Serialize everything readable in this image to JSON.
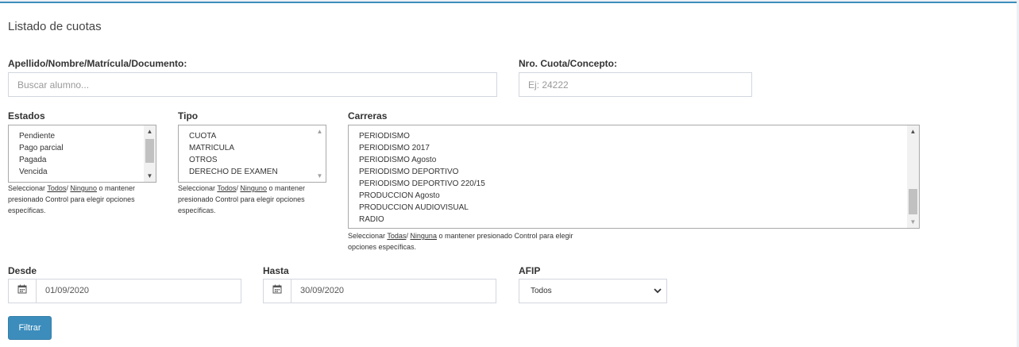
{
  "page": {
    "title": "Listado de cuotas"
  },
  "search": {
    "label": "Apellido/Nombre/Matrícula/Documento:",
    "placeholder": "Buscar alumno..."
  },
  "concepto": {
    "label": "Nro. Cuota/Concepto:",
    "placeholder": "Ej: 24222"
  },
  "estados": {
    "label": "Estados",
    "options": [
      "Pendiente",
      "Pago parcial",
      "Pagada",
      "Vencida"
    ],
    "help": {
      "pre": "Seleccionar ",
      "all": "Todos",
      "sep": "/ ",
      "none": "Ninguno",
      "post1": " o mantener",
      "post2": "presionado Control para elegir opciones",
      "post3": "específicas."
    }
  },
  "tipo": {
    "label": "Tipo",
    "options": [
      "CUOTA",
      "MATRICULA",
      "OTROS",
      "DERECHO DE EXAMEN"
    ],
    "help": {
      "pre": "Seleccionar ",
      "all": "Todos",
      "sep": "/ ",
      "none": "Ninguno",
      "post1": " o mantener",
      "post2": "presionado Control para elegir opciones",
      "post3": "específicas."
    }
  },
  "carreras": {
    "label": "Carreras",
    "options": [
      "PERIODISMO",
      "PERIODISMO 2017",
      "PERIODISMO Agosto",
      "PERIODISMO DEPORTIVO",
      "PERIODISMO DEPORTIVO 220/15",
      "PRODUCCION Agosto",
      "PRODUCCION AUDIOVISUAL",
      "RADIO"
    ],
    "help": {
      "pre": "Seleccionar ",
      "all": "Todas",
      "sep": "/ ",
      "none": "Ninguna",
      "post1": " o mantener presionado Control para elegir",
      "post2": "opciones específicas."
    }
  },
  "desde": {
    "label": "Desde",
    "value": "01/09/2020"
  },
  "hasta": {
    "label": "Hasta",
    "value": "30/09/2020"
  },
  "afip": {
    "label": "AFIP",
    "value": "Todos"
  },
  "filter_button": {
    "label": "Filtrar"
  },
  "colors": {
    "primary": "#3c8dbc",
    "top_border": "#3c8dbc"
  }
}
